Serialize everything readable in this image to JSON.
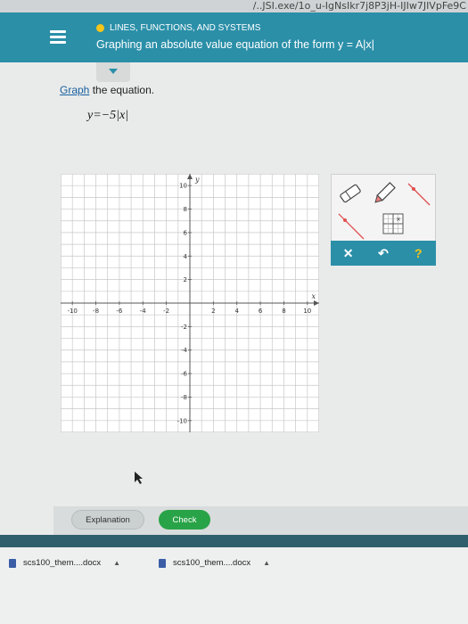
{
  "browser": {
    "url_fragment": "/..JSI.exe/1o_u-IgNsIkr7j8P3jH-IJIw7JIVpFe9C"
  },
  "header": {
    "topic": "LINES, FUNCTIONS, AND SYSTEMS",
    "title": "Graphing an absolute value equation of the form y = A|x|"
  },
  "problem": {
    "instruction_link": "Graph",
    "instruction_rest": " the equation.",
    "equation": "y=−5|x|"
  },
  "graph": {
    "x_label": "x",
    "y_label": "y",
    "x_ticks": [
      "-10",
      "-8",
      "-6",
      "-4",
      "-2",
      "2",
      "4",
      "6",
      "8",
      "10"
    ],
    "y_ticks": [
      "10",
      "8",
      "6",
      "4",
      "2",
      "-2",
      "-4",
      "-6",
      "-8",
      "-10"
    ],
    "xlim": [
      -11,
      11
    ],
    "ylim": [
      -11,
      11
    ]
  },
  "toolbox": {
    "tools": [
      {
        "name": "eraser-icon"
      },
      {
        "name": "pencil-icon"
      },
      {
        "name": "line-tool-icon"
      },
      {
        "name": "ray-tool-icon"
      },
      {
        "name": "point-grid-icon"
      }
    ],
    "actions": {
      "clear": "✕",
      "undo": "↶",
      "help": "?"
    }
  },
  "footer": {
    "explanation_label": "Explanation",
    "check_label": "Check"
  },
  "downloads": {
    "items": [
      {
        "name": "scs100_them....docx"
      },
      {
        "name": "scs100_them....docx"
      }
    ]
  }
}
